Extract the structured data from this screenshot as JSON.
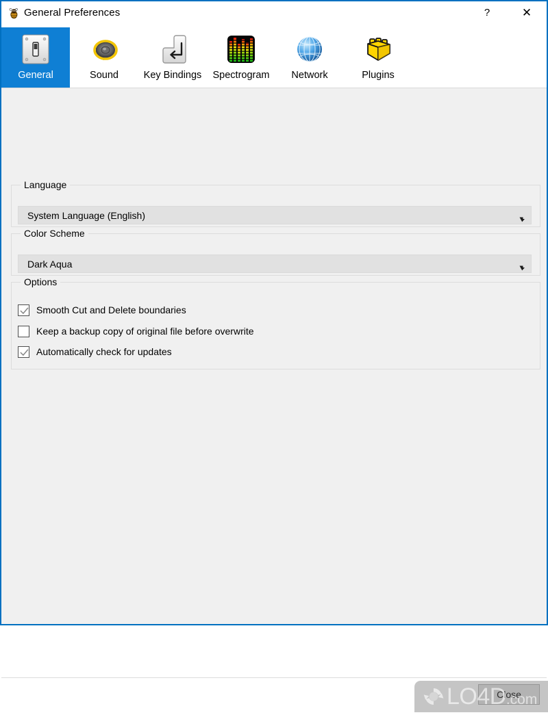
{
  "window": {
    "title": "General Preferences",
    "icon": "bee-app-icon",
    "border_color": "#0070c0",
    "help_label": "?",
    "close_label": "✕"
  },
  "tabs": [
    {
      "label": "General",
      "icon": "light-switch-icon",
      "selected": true
    },
    {
      "label": "Sound",
      "icon": "speaker-icon",
      "selected": false
    },
    {
      "label": "Key Bindings",
      "icon": "enter-key-icon",
      "selected": false
    },
    {
      "label": "Spectrogram",
      "icon": "spectrogram-icon",
      "selected": false
    },
    {
      "label": "Network",
      "icon": "globe-network-icon",
      "selected": false
    },
    {
      "label": "Plugins",
      "icon": "lego-brick-icon",
      "selected": false
    }
  ],
  "selected_tab_color": "#0f7fd4",
  "groups": {
    "language": {
      "title": "Language",
      "combo": {
        "value": "System Language (English)"
      }
    },
    "color_scheme": {
      "title": "Color Scheme",
      "combo": {
        "value": "Dark Aqua"
      }
    },
    "options": {
      "title": "Options",
      "checkboxes": [
        {
          "label": "Smooth Cut and Delete boundaries",
          "checked": true
        },
        {
          "label": "Keep a backup copy of original file before overwrite",
          "checked": false
        },
        {
          "label": "Automatically check for updates",
          "checked": true
        }
      ]
    }
  },
  "footer": {
    "close_label": "Close"
  },
  "watermark": {
    "text": "LO4D",
    "suffix": ".com",
    "logo": "circular-arrows-icon"
  }
}
